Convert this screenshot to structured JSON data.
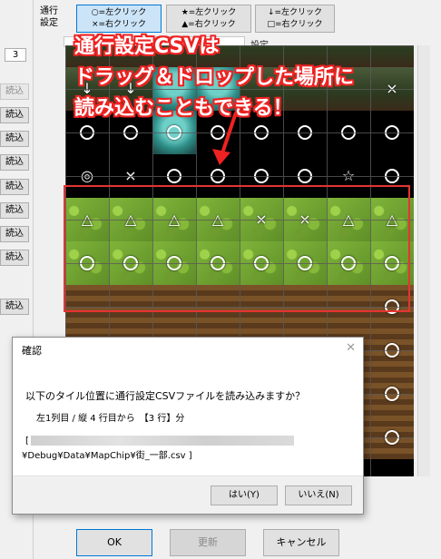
{
  "left_panel": {
    "number_value": "3",
    "load_button_label": "読込"
  },
  "header": {
    "passage_setting_label": "通行\n設定",
    "mode_buttons": [
      {
        "line1": "○=左クリック",
        "line2": "×=右クリック"
      },
      {
        "line1": "★=左クリック",
        "line2": "▲=右クリック"
      },
      {
        "line1": "↓=左クリック",
        "line2": "□=右クリック"
      }
    ],
    "csv_label": "設定"
  },
  "callout": {
    "line1": "通行設定CSVは",
    "line2": "ドラッグ＆ドロップした場所に",
    "line3": "読み込むこともできる！"
  },
  "dialog": {
    "title": "確認",
    "close_icon": "close-icon",
    "message": "以下のタイル位置に通行設定CSVファイルを読み込みますか？",
    "position": "左1列目 / 縦 4 行目から　【3 行】分",
    "path_prefix": "[",
    "path_suffix": "¥Debug¥Data¥MapChip¥街_一部.csv ]",
    "yes_label": "はい(Y)",
    "no_label": "いいえ(N)"
  },
  "footer": {
    "ok_label": "OK",
    "update_label": "更新",
    "cancel_label": "キャンセル"
  },
  "colors": {
    "highlight_red": "#e53333",
    "active_button": "#cce4f7"
  }
}
